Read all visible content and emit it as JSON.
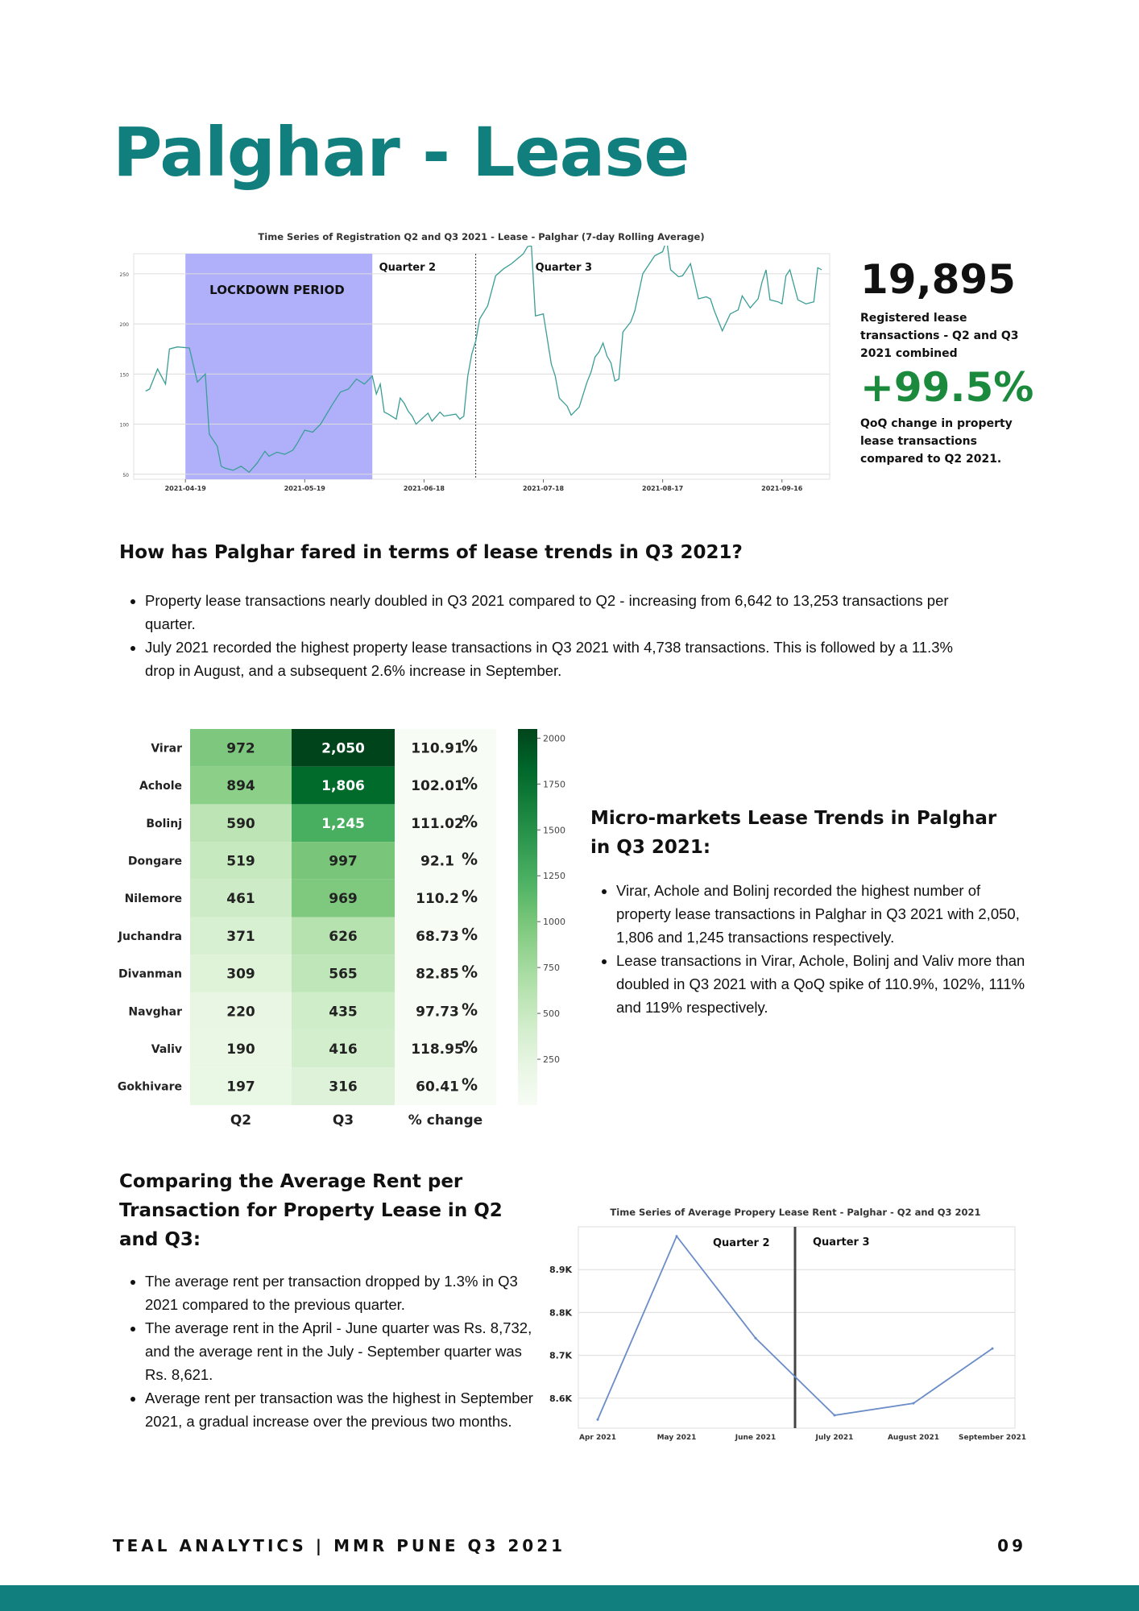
{
  "page": {
    "title": "Palghar - Lease",
    "footer": "TEAL ANALYTICS | MMR PUNE Q3 2021",
    "page_number": "09"
  },
  "stats": {
    "total_value": "19,895",
    "total_caption": "Registered lease transactions - Q2 and Q3 2021 combined",
    "change_value": "+99.5%",
    "change_caption": "QoQ change in property lease transactions compared to Q2 2021."
  },
  "section1": {
    "heading": "How has Palghar fared in terms of lease trends in Q3 2021?",
    "bullets": [
      "Property  lease transactions nearly doubled in Q3 2021 compared to Q2 - increasing from 6,642 to 13,253 transactions per quarter.",
      "July 2021 recorded the highest property lease transactions in Q3 2021 with 4,738 transactions. This is followed by a 11.3% drop in August, and a subsequent  2.6% increase in September."
    ]
  },
  "section2": {
    "heading": "Micro-markets Lease Trends in Palghar in Q3 2021:",
    "bullets": [
      "Virar, Achole and Bolinj recorded the highest number of property lease transactions in Palghar in Q3 2021 with 2,050, 1,806 and 1,245 transactions respectively.",
      "Lease transactions in Virar, Achole, Bolinj and Valiv more than doubled in Q3 2021 with a QoQ spike of 110.9%, 102%,  111% and 119% respectively."
    ]
  },
  "section3": {
    "heading": "Comparing the Average Rent per Transaction for Property Lease in Q2 and Q3:",
    "bullets": [
      "The average rent per transaction dropped by 1.3% in Q3 2021 compared to the previous quarter.",
      "The average rent in the  April - June quarter was Rs. 8,732, and the average rent in the July - September quarter was Rs. 8,621.",
      "Average rent per transaction was the highest in September 2021, a gradual increase over the previous two months."
    ]
  },
  "chart_data": [
    {
      "type": "line",
      "title": "Time Series of Registration Q2 and Q3 2021 - Lease - Palghar (7-day Rolling Average)",
      "x_tick_labels": [
        "2021-04-19",
        "2021-05-19",
        "2021-06-18",
        "2021-07-18",
        "2021-08-17",
        "2021-09-16"
      ],
      "y_tick_labels": [
        "50",
        "100",
        "150",
        "200",
        "250"
      ],
      "ylim": [
        45,
        270
      ],
      "xlim": [
        "2021-04-06",
        "2021-09-28"
      ],
      "grid": true,
      "annotations": [
        "LOCKDOWN PERIOD",
        "Quarter 2",
        "Quarter 3"
      ],
      "lockdown_span": [
        "2021-04-19",
        "2021-06-05"
      ],
      "quarter_divider": "2021-07-01",
      "series": [
        {
          "color": "#3a9e96",
          "x": [
            "2021-04-09",
            "2021-04-10",
            "2021-04-12",
            "2021-04-14",
            "2021-04-15",
            "2021-04-17",
            "2021-04-20",
            "2021-04-22",
            "2021-04-24",
            "2021-04-25",
            "2021-04-27",
            "2021-04-28",
            "2021-04-29",
            "2021-05-01",
            "2021-05-03",
            "2021-05-05",
            "2021-05-07",
            "2021-05-09",
            "2021-05-10",
            "2021-05-12",
            "2021-05-14",
            "2021-05-16",
            "2021-05-17",
            "2021-05-19",
            "2021-05-21",
            "2021-05-23",
            "2021-05-26",
            "2021-05-28",
            "2021-05-30",
            "2021-06-01",
            "2021-06-03",
            "2021-06-05",
            "2021-06-06",
            "2021-06-07",
            "2021-06-08",
            "2021-06-09",
            "2021-06-11",
            "2021-06-12",
            "2021-06-13",
            "2021-06-14",
            "2021-06-15",
            "2021-06-16",
            "2021-06-19",
            "2021-06-20",
            "2021-06-22",
            "2021-06-23",
            "2021-06-26",
            "2021-06-27",
            "2021-06-28",
            "2021-06-29",
            "2021-06-30",
            "2021-07-01",
            "2021-07-02",
            "2021-07-04",
            "2021-07-06",
            "2021-07-08",
            "2021-07-10",
            "2021-07-13",
            "2021-07-14",
            "2021-07-15",
            "2021-07-16",
            "2021-07-18",
            "2021-07-20",
            "2021-07-21",
            "2021-07-22",
            "2021-07-24",
            "2021-07-25",
            "2021-07-26",
            "2021-07-27",
            "2021-07-29",
            "2021-07-30",
            "2021-07-31",
            "2021-08-01",
            "2021-08-02",
            "2021-08-03",
            "2021-08-04",
            "2021-08-05",
            "2021-08-06",
            "2021-08-07",
            "2021-08-09",
            "2021-08-10",
            "2021-08-12",
            "2021-08-15",
            "2021-08-17",
            "2021-08-18",
            "2021-08-19",
            "2021-08-21",
            "2021-08-22",
            "2021-08-23",
            "2021-08-24",
            "2021-08-26",
            "2021-08-28",
            "2021-08-29",
            "2021-08-30",
            "2021-09-01",
            "2021-09-03",
            "2021-09-05",
            "2021-09-06",
            "2021-09-08",
            "2021-09-10",
            "2021-09-11",
            "2021-09-12",
            "2021-09-13",
            "2021-09-15",
            "2021-09-16",
            "2021-09-17",
            "2021-09-18",
            "2021-09-20",
            "2021-09-22",
            "2021-09-24",
            "2021-09-25",
            "2021-09-26"
          ],
          "y": [
            133,
            135,
            155,
            140,
            175,
            177,
            176,
            142,
            150,
            90,
            78,
            58,
            56,
            54,
            58,
            52,
            61,
            73,
            68,
            72,
            70,
            74,
            80,
            94,
            92,
            100,
            120,
            132,
            135,
            145,
            140,
            148,
            130,
            140,
            112,
            110,
            105,
            126,
            121,
            113,
            108,
            100,
            111,
            103,
            112,
            108,
            110,
            105,
            108,
            148,
            170,
            183,
            205,
            218,
            248,
            255,
            260,
            270,
            277,
            278,
            208,
            210,
            160,
            148,
            126,
            118,
            109,
            113,
            117,
            142,
            152,
            167,
            172,
            181,
            168,
            161,
            143,
            145,
            192,
            202,
            213,
            250,
            268,
            272,
            284,
            254,
            247,
            248,
            254,
            260,
            225,
            227,
            225,
            213,
            193,
            210,
            214,
            228,
            216,
            225,
            242,
            254,
            224,
            222,
            220,
            248,
            254,
            224,
            220,
            222,
            256,
            254
          ]
        }
      ]
    },
    {
      "type": "heatmap",
      "categories": [
        "Virar",
        "Achole",
        "Bolinj",
        "Dongare",
        "Nilemore",
        "Juchandra",
        "Divanman",
        "Navghar",
        "Valiv",
        "Gokhivare"
      ],
      "columns": [
        "Q2",
        "Q3",
        "% change"
      ],
      "q2": [
        "972",
        "894",
        "590",
        "519",
        "461",
        "371",
        "309",
        "220",
        "190",
        "197"
      ],
      "q3": [
        "2,050",
        "1,806",
        "1,245",
        "997",
        "969",
        "626",
        "565",
        "435",
        "416",
        "316"
      ],
      "pct": [
        "110.91",
        "102.01",
        "111.02",
        "92.1",
        "110.2",
        "68.73",
        "82.85",
        "97.73",
        "118.95",
        "60.41"
      ],
      "q2_values": [
        972,
        894,
        590,
        519,
        461,
        371,
        309,
        220,
        190,
        197
      ],
      "q3_values": [
        2050,
        1806,
        1245,
        997,
        969,
        626,
        565,
        435,
        416,
        316
      ],
      "pct_symbol": "%",
      "colorbar_ticks": [
        "250",
        "500",
        "750",
        "1000",
        "1250",
        "1500",
        "1750",
        "2000"
      ],
      "colorbar_range": [
        0,
        2050
      ],
      "colormap": "Greens"
    },
    {
      "type": "line",
      "title": "Time Series of Average Propery Lease Rent - Palghar - Q2 and Q3 2021",
      "categories": [
        "Apr 2021",
        "May 2021",
        "June 2021",
        "July 2021",
        "August 2021",
        "September 2021"
      ],
      "values": [
        8550,
        8978,
        8740,
        8560,
        8588,
        8716
      ],
      "y_tick_labels": [
        "8.6K",
        "8.7K",
        "8.8K",
        "8.9K"
      ],
      "ylim": [
        8530,
        9000
      ],
      "annotations": [
        "Quarter 2",
        "Quarter 3"
      ],
      "grid": true,
      "color": "#6a8cc7"
    }
  ]
}
